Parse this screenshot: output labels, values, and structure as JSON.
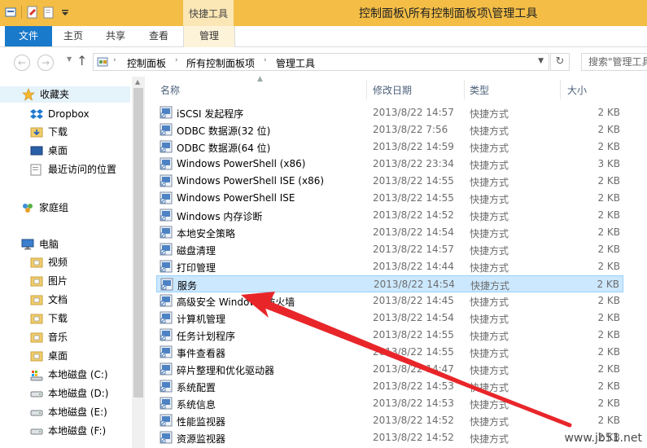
{
  "window": {
    "title": "控制面板\\所有控制面板项\\管理工具",
    "contextual_tab_group": "快捷工具"
  },
  "ribbon": {
    "tabs": [
      "文件",
      "主页",
      "共享",
      "查看",
      "管理"
    ]
  },
  "address": {
    "crumbs": [
      "控制面板",
      "所有控制面板项",
      "管理工具"
    ],
    "search_placeholder": "搜索\"管理工具\""
  },
  "nav": {
    "favorites": "收藏夹",
    "favorites_items": [
      "Dropbox",
      "下载",
      "桌面",
      "最近访问的位置"
    ],
    "homegroup": "家庭组",
    "computer": "电脑",
    "computer_items": [
      "视频",
      "图片",
      "文档",
      "下载",
      "音乐",
      "桌面",
      "本地磁盘 (C:)",
      "本地磁盘 (D:)",
      "本地磁盘 (E:)",
      "本地磁盘 (F:)"
    ]
  },
  "columns": {
    "name": "名称",
    "date": "修改日期",
    "type": "类型",
    "size": "大小"
  },
  "files": [
    {
      "name": "iSCSI 发起程序",
      "date": "2013/8/22 14:57",
      "type": "快捷方式",
      "size": "2 KB"
    },
    {
      "name": "ODBC 数据源(32 位)",
      "date": "2013/8/22 7:56",
      "type": "快捷方式",
      "size": "2 KB"
    },
    {
      "name": "ODBC 数据源(64 位)",
      "date": "2013/8/22 14:59",
      "type": "快捷方式",
      "size": "2 KB"
    },
    {
      "name": "Windows PowerShell (x86)",
      "date": "2013/8/22 23:34",
      "type": "快捷方式",
      "size": "3 KB"
    },
    {
      "name": "Windows PowerShell ISE (x86)",
      "date": "2013/8/22 14:55",
      "type": "快捷方式",
      "size": "2 KB"
    },
    {
      "name": "Windows PowerShell ISE",
      "date": "2013/8/22 14:55",
      "type": "快捷方式",
      "size": "2 KB"
    },
    {
      "name": "Windows 内存诊断",
      "date": "2013/8/22 14:52",
      "type": "快捷方式",
      "size": "2 KB"
    },
    {
      "name": "本地安全策略",
      "date": "2013/8/22 14:54",
      "type": "快捷方式",
      "size": "2 KB"
    },
    {
      "name": "磁盘清理",
      "date": "2013/8/22 14:57",
      "type": "快捷方式",
      "size": "2 KB"
    },
    {
      "name": "打印管理",
      "date": "2013/8/22 14:44",
      "type": "快捷方式",
      "size": "2 KB"
    },
    {
      "name": "服务",
      "date": "2013/8/22 14:54",
      "type": "快捷方式",
      "size": "2 KB",
      "selected": true
    },
    {
      "name": "高级安全 Windows 防火墙",
      "date": "2013/8/22 14:45",
      "type": "快捷方式",
      "size": "2 KB"
    },
    {
      "name": "计算机管理",
      "date": "2013/8/22 14:54",
      "type": "快捷方式",
      "size": "2 KB"
    },
    {
      "name": "任务计划程序",
      "date": "2013/8/22 14:55",
      "type": "快捷方式",
      "size": "2 KB"
    },
    {
      "name": "事件查看器",
      "date": "2013/8/22 14:55",
      "type": "快捷方式",
      "size": "2 KB"
    },
    {
      "name": "碎片整理和优化驱动器",
      "date": "2013/8/22 14:47",
      "type": "快捷方式",
      "size": "2 KB"
    },
    {
      "name": "系统配置",
      "date": "2013/8/22 14:53",
      "type": "快捷方式",
      "size": "2 KB"
    },
    {
      "name": "系统信息",
      "date": "2013/8/22 14:53",
      "type": "快捷方式",
      "size": "2 KB"
    },
    {
      "name": "性能监视器",
      "date": "2013/8/22 14:52",
      "type": "快捷方式",
      "size": "2 KB"
    },
    {
      "name": "资源监视器",
      "date": "2013/8/22 14:52",
      "type": "快捷方式",
      "size": "2 KB"
    }
  ],
  "watermark": "www.jb51.net",
  "colors": {
    "titlebar": "#f3bd46",
    "file_tab": "#1979ca",
    "selection": "#cce8ff",
    "arrow": "#e8262a"
  }
}
